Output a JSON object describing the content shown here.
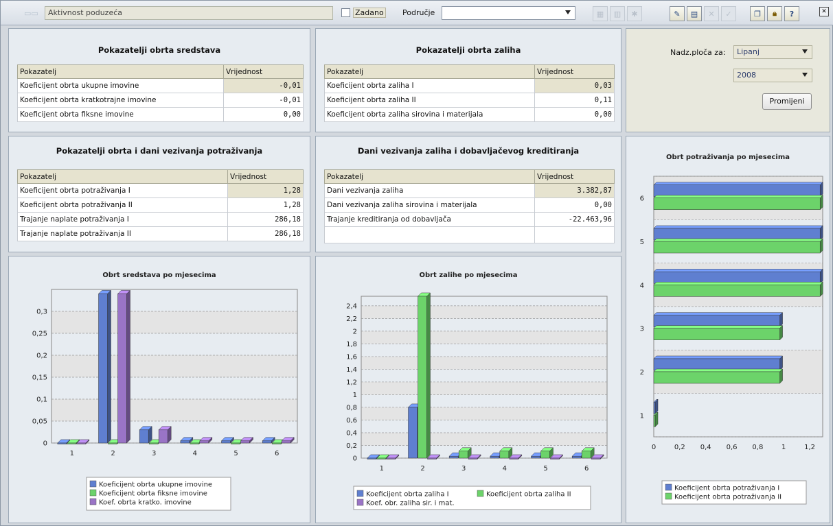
{
  "toolbar": {
    "name_value": "Aktivnost poduzeća",
    "zadano_label": "Zadano",
    "podrucje_label": "Područje",
    "podrucje_value": ""
  },
  "panels": {
    "obrt_sredstava": {
      "title": "Pokazatelji obrta sredstava",
      "col1": "Pokazatelj",
      "col2": "Vrijednost",
      "rows": [
        {
          "label": "Koeficijent obrta ukupne imovine",
          "value": "-0,01"
        },
        {
          "label": "Koeficijent obrta kratkotrajne imovine",
          "value": "-0,01"
        },
        {
          "label": "Koeficijent obrta fiksne imovine",
          "value": "0,00"
        }
      ]
    },
    "obrt_zaliha": {
      "title": "Pokazatelji obrta zaliha",
      "col1": "Pokazatelj",
      "col2": "Vrijednost",
      "rows": [
        {
          "label": "Koeficijent obrta zaliha I",
          "value": "0,03"
        },
        {
          "label": "Koeficijent obrta zaliha II",
          "value": "0,11"
        },
        {
          "label": "Koeficijent obrta zaliha sirovina i materijala",
          "value": "0,00"
        }
      ]
    },
    "nadzorna": {
      "label": "Nadz.ploča za:",
      "month": "Lipanj",
      "year": "2008",
      "button": "Promijeni"
    },
    "obrt_potrazivanja": {
      "title": "Pokazatelji obrta i dani vezivanja potraživanja",
      "col1": "Pokazatelj",
      "col2": "Vrijednost",
      "rows": [
        {
          "label": "Koeficijent obrta potraživanja I",
          "value": "1,28"
        },
        {
          "label": "Koeficijent obrta potraživanja II",
          "value": "1,28"
        },
        {
          "label": "Trajanje naplate potraživanja I",
          "value": "286,18"
        },
        {
          "label": "Trajanje naplate potraživanja II",
          "value": "286,18"
        }
      ]
    },
    "dani_vezivanja": {
      "title": "Dani vezivanja zaliha i dobavljačevog kreditiranja",
      "col1": "Pokazatelj",
      "col2": "Vrijednost",
      "rows": [
        {
          "label": "Dani vezivanja zaliha",
          "value": "3.382,87"
        },
        {
          "label": "Dani vezivanja zaliha sirovina i materijala",
          "value": "0,00"
        },
        {
          "label": "Trajanje kreditiranja od dobavljača",
          "value": "-22.463,96"
        }
      ]
    }
  },
  "colors": {
    "blue": "#5f7fd0",
    "green": "#6cd36a",
    "purple": "#9a74c6"
  },
  "chart_data": [
    {
      "type": "bar",
      "title": "Obrt sredstava po mjesecima",
      "categories": [
        "1",
        "2",
        "3",
        "4",
        "5",
        "6"
      ],
      "ylim": [
        0,
        0.35
      ],
      "yticks": [
        "0",
        "0,05",
        "0,1",
        "0,15",
        "0,2",
        "0,25",
        "0,3"
      ],
      "yvals": [
        0,
        0.05,
        0.1,
        0.15,
        0.2,
        0.25,
        0.3
      ],
      "series": [
        {
          "name": "Koeficijent obrta ukupne imovine",
          "color": "#5f7fd0",
          "values": [
            0,
            0.34,
            0.03,
            0.005,
            0.005,
            0.005
          ]
        },
        {
          "name": "Koeficijent obrta fiksne imovine",
          "color": "#6cd36a",
          "values": [
            0,
            0,
            0,
            0,
            0,
            0
          ]
        },
        {
          "name": "Koef. obrta kratko. imovine",
          "color": "#9a74c6",
          "values": [
            0,
            0.34,
            0.03,
            0.005,
            0.005,
            0.005
          ]
        }
      ],
      "grid": true,
      "legend": "bottom"
    },
    {
      "type": "bar",
      "title": "Obrt zalihe po mjesecima",
      "categories": [
        "1",
        "2",
        "3",
        "4",
        "5",
        "6"
      ],
      "ylim": [
        0,
        2.55
      ],
      "yticks": [
        "0",
        "0,2",
        "0,4",
        "0,6",
        "0,8",
        "1",
        "1,2",
        "1,4",
        "1,6",
        "1,8",
        "2",
        "2,2",
        "2,4"
      ],
      "yvals": [
        0,
        0.2,
        0.4,
        0.6,
        0.8,
        1,
        1.2,
        1.4,
        1.6,
        1.8,
        2,
        2.2,
        2.4
      ],
      "series": [
        {
          "name": "Koeficijent obrta zaliha I",
          "color": "#5f7fd0",
          "values": [
            0,
            0.8,
            0.03,
            0.03,
            0.03,
            0.03
          ]
        },
        {
          "name": "Koeficijent obrta zaliha II",
          "color": "#6cd36a",
          "values": [
            0,
            2.55,
            0.11,
            0.11,
            0.11,
            0.11
          ]
        },
        {
          "name": "Koef. obr. zaliha sir. i mat.",
          "color": "#9a74c6",
          "values": [
            0,
            0,
            0,
            0,
            0,
            0
          ]
        }
      ],
      "grid": true,
      "legend": "bottom"
    },
    {
      "type": "bar",
      "orientation": "horizontal",
      "title": "Obrt potraživanja po mjesecima",
      "categories": [
        "1",
        "2",
        "3",
        "4",
        "5",
        "6"
      ],
      "xlim": [
        0,
        1.3
      ],
      "xticks": [
        "0",
        "0,2",
        "0,4",
        "0,6",
        "0,8",
        "1",
        "1,2"
      ],
      "xvals": [
        0,
        0.2,
        0.4,
        0.6,
        0.8,
        1,
        1.2
      ],
      "series": [
        {
          "name": "Koeficijent obrta potraživanja I",
          "color": "#5f7fd0",
          "values": [
            0,
            0.97,
            0.97,
            1.28,
            1.28,
            1.28
          ]
        },
        {
          "name": "Koeficijent obrta potraživanja II",
          "color": "#6cd36a",
          "values": [
            0,
            0.97,
            0.97,
            1.28,
            1.28,
            1.28
          ]
        }
      ],
      "grid": true,
      "legend": "bottom"
    }
  ]
}
